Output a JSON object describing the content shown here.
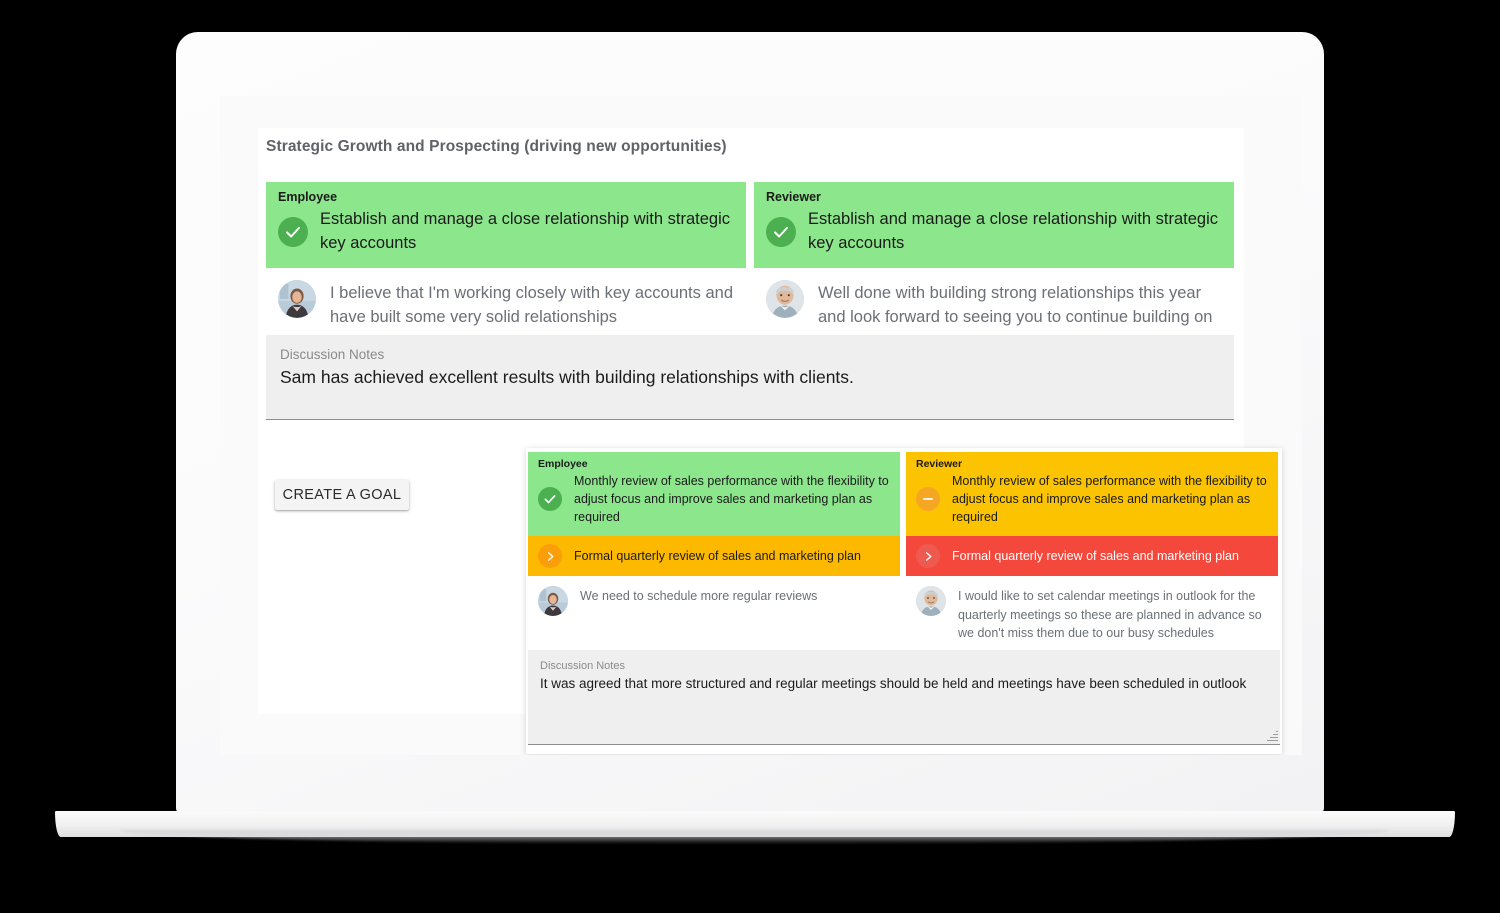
{
  "section": {
    "title": "Strategic Growth and Prospecting (driving new opportunities)"
  },
  "roles": {
    "employee": "Employee",
    "reviewer": "Reviewer"
  },
  "goal1": {
    "employee": {
      "role": "Employee",
      "status_icon": "check-circle-icon",
      "status_color": "#4caf50",
      "card_color": "#8ce68c",
      "text": "Establish and manage a close relationship with strategic key accounts",
      "comment": "I believe that I'm working closely with key accounts and have built some very solid relationships",
      "avatar": "female-employee-avatar"
    },
    "reviewer": {
      "role": "Reviewer",
      "status_icon": "check-circle-icon",
      "status_color": "#4caf50",
      "card_color": "#8ce68c",
      "text": "Establish and manage a close relationship with strategic key accounts",
      "comment": "Well done with building strong relationships this year and look forward to seeing you to continue building on these",
      "avatar": "male-reviewer-avatar"
    },
    "notes": {
      "label": "Discussion Notes",
      "value": "Sam has achieved excellent results with building relationships with clients."
    }
  },
  "buttons": {
    "create_goal": "CREATE A GOAL"
  },
  "goal2": {
    "employee": {
      "role": "Employee",
      "status_icon": "check-circle-icon",
      "status_color": "#4caf50",
      "card_color": "#8ce68c",
      "text": "Monthly review of sales performance with the flexibility to adjust focus and improve sales and marketing plan as required",
      "subitem": {
        "icon": "chevron-right-circle-icon",
        "icon_color": "#fa9e0a",
        "bar_color": "#fcb900",
        "text": "Formal quarterly review of sales and marketing plan"
      },
      "comment": "We need to schedule more regular reviews",
      "avatar": "female-employee-avatar"
    },
    "reviewer": {
      "role": "Reviewer",
      "status_icon": "minus-circle-icon",
      "status_color": "#f5a623",
      "card_color": "#fcc300",
      "text": "Monthly review of sales performance with the flexibility to adjust focus and improve sales and marketing plan as required",
      "subitem": {
        "icon": "chevron-right-circle-icon",
        "icon_color": "#ef5a50",
        "bar_color": "#f4483c",
        "text": "Formal quarterly review of sales and marketing plan"
      },
      "comment": "I would like to set calendar meetings in outlook for the quarterly meetings so these are planned in advance so we don't miss them due to our busy schedules",
      "avatar": "male-reviewer-avatar"
    },
    "notes": {
      "label": "Discussion Notes",
      "value": "It was agreed that more structured and regular meetings should be held and meetings have been scheduled in outlook"
    }
  }
}
